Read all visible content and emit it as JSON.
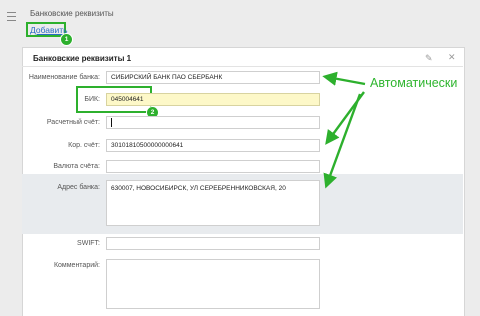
{
  "header": {
    "section_title": "Банковские реквизиты",
    "add_label": "Добавить"
  },
  "card": {
    "title": "Банковские реквизиты 1"
  },
  "fields": {
    "bank_name": {
      "label": "Наименование банка:",
      "value": "СИБИРСКИЙ БАНК ПАО СБЕРБАНК"
    },
    "bik": {
      "label": "БИК:",
      "value": "045004641"
    },
    "account": {
      "label": "Расчетный счёт:",
      "value": ""
    },
    "corr_account": {
      "label": "Кор. счёт:",
      "value": "30101810500000000641"
    },
    "currency": {
      "label": "Валюта счёта:",
      "value": ""
    },
    "bank_address": {
      "label": "Адрес банка:",
      "value": "630007, НОВОСИБИРСК, УЛ СЕРЕБРЕННИКОВСКАЯ, 20"
    },
    "swift": {
      "label": "SWIFT:",
      "value": ""
    },
    "comment": {
      "label": "Комментарий:",
      "value": ""
    }
  },
  "annotations": {
    "callout": "Автоматически",
    "badge_1": "1",
    "badge_2": "2",
    "accent_color": "#2db02d"
  },
  "icons": {
    "menu": "hamburger-icon",
    "edit": "pencil-icon",
    "close": "close-icon"
  }
}
